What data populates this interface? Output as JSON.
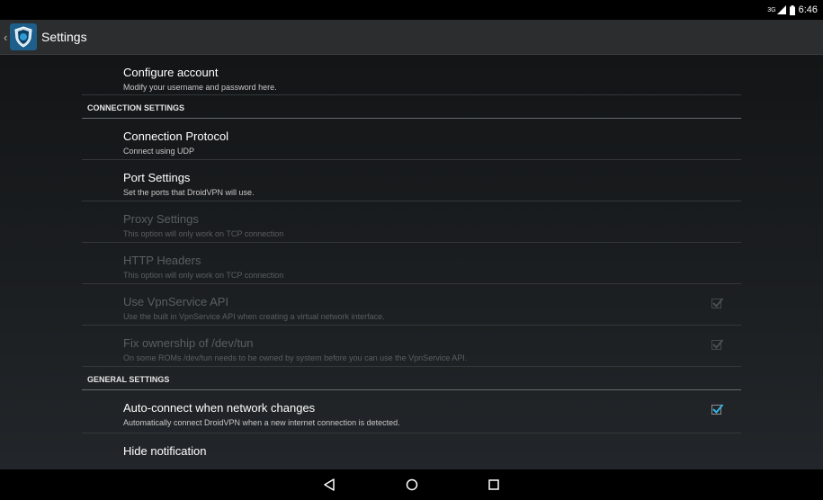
{
  "status_bar": {
    "network": "3G",
    "time": "6:46"
  },
  "action_bar": {
    "title": "Settings",
    "icon": "shield-app-icon"
  },
  "top_item": {
    "title": "Configure account",
    "summary": "Modify your username and password here."
  },
  "connection_header": "CONNECTION SETTINGS",
  "connection_items": [
    {
      "title": "Connection Protocol",
      "summary": "Connect using UDP",
      "enabled": true
    },
    {
      "title": "Port Settings",
      "summary": "Set the ports that DroidVPN will use.",
      "enabled": true
    },
    {
      "title": "Proxy Settings",
      "summary": "This option will only work on TCP connection",
      "enabled": false
    },
    {
      "title": "HTTP Headers",
      "summary": "This option will only work on TCP connection",
      "enabled": false
    },
    {
      "title": "Use VpnService API",
      "summary": "Use the built in VpnService API when creating a virtual network interface.",
      "enabled": false,
      "checked": true
    },
    {
      "title": "Fix ownership of /dev/tun",
      "summary": "On some ROMs /dev/tun needs to be owned by system before you can use the VpnService API.",
      "enabled": false,
      "checked": true
    }
  ],
  "general_header": "GENERAL SETTINGS",
  "general_items": [
    {
      "title": "Auto-connect when network changes",
      "summary": "Automatically connect DroidVPN when a new internet connection is detected.",
      "enabled": true,
      "checked": true
    },
    {
      "title": "Hide notification",
      "summary": ""
    }
  ],
  "colors": {
    "accent": "#33b5e5",
    "background": "#1a1d20",
    "disabled_text": "#5a5e62"
  },
  "nav": [
    "back-icon",
    "home-icon",
    "recents-icon"
  ]
}
